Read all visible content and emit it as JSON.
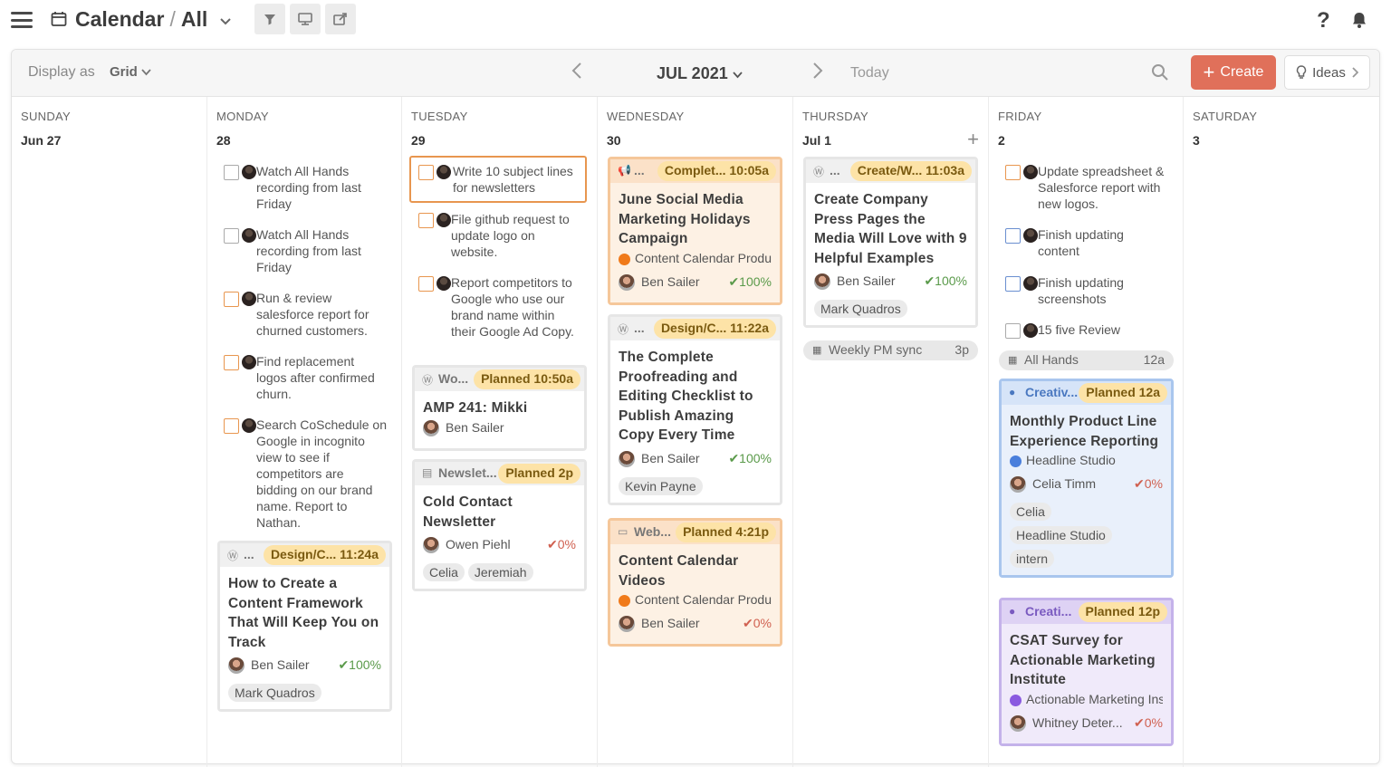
{
  "header": {
    "app": "Calendar",
    "filter": "All"
  },
  "toolbar": {
    "display_as": "Display as",
    "view": "Grid",
    "month": "JUL 2021",
    "today": "Today",
    "create": "Create",
    "ideas": "Ideas"
  },
  "days": [
    {
      "name": "SUNDAY",
      "num": "Jun 27"
    },
    {
      "name": "MONDAY",
      "num": "28"
    },
    {
      "name": "TUESDAY",
      "num": "29"
    },
    {
      "name": "WEDNESDAY",
      "num": "30"
    },
    {
      "name": "THURSDAY",
      "num": "Jul 1"
    },
    {
      "name": "FRIDAY",
      "num": "2"
    },
    {
      "name": "SATURDAY",
      "num": "3"
    }
  ],
  "monday": {
    "t1": "Watch All Hands recording from last Friday",
    "t2": "Watch All Hands recording from last Friday",
    "t3": "Run & review salesforce report for churned customers.",
    "t4": "Find replacement logos after confirmed churn.",
    "t5": "Search CoSchedule on Google in incognito view to see if competitors are bidding on our brand name. Report to Nathan.",
    "card": {
      "label": "...",
      "status": "Design/C... 11:24a",
      "title": "How to Create a Content Framework That Will Keep You on Track",
      "person": "Ben Sailer",
      "pct": "✔100%",
      "tag1": "Mark Quadros"
    }
  },
  "tuesday": {
    "t1": "Write 10 subject lines for newsletters",
    "t2": "File github request to update logo on website.",
    "t3": "Report competitors to Google who use our brand name within their Google Ad Copy.",
    "card1": {
      "label": "Wo...",
      "status": "Planned 10:50a",
      "title": "AMP 241: Mikki",
      "person": "Ben Sailer"
    },
    "card2": {
      "label": "Newslet...",
      "status": "Planned 2p",
      "title": "Cold Contact Newsletter",
      "person": "Owen Piehl",
      "pct": "✔0%",
      "tag1": "Celia",
      "tag2": "Jeremiah"
    }
  },
  "wednesday": {
    "card1": {
      "label": "...",
      "status": "Complet... 10:05a",
      "title": "June Social Media Marketing Holidays Campaign",
      "project": "Content Calendar Produ",
      "person": "Ben Sailer",
      "pct": "✔100%"
    },
    "card2": {
      "label": "...",
      "status": "Design/C... 11:22a",
      "title": "The Complete Proofreading and Editing Checklist to Publish Amazing Copy Every Time",
      "person": "Ben Sailer",
      "pct": "✔100%",
      "tag1": "Kevin Payne"
    },
    "card3": {
      "label": "Web...",
      "status": "Planned 4:21p",
      "title": "Content Calendar Videos",
      "project": "Content Calendar Produ",
      "person": "Ben Sailer",
      "pct": "✔0%"
    }
  },
  "thursday": {
    "card1": {
      "label": "...",
      "status": "Create/W... 11:03a",
      "title": "Create Company Press Pages the Media Will Love with 9 Helpful Examples",
      "person": "Ben Sailer",
      "pct": "✔100%",
      "tag1": "Mark Quadros"
    },
    "event": {
      "title": "Weekly PM sync",
      "time": "3p"
    }
  },
  "friday": {
    "t1": "Update spreadsheet & Salesforce report with new logos.",
    "t2": "Finish updating content",
    "t3": "Finish updating screenshots",
    "t4": "15 five Review",
    "event": {
      "title": "All Hands",
      "time": "12a"
    },
    "card1": {
      "label": "Creativ...",
      "status": "Planned 12a",
      "title": "Monthly Product Line Experience Reporting",
      "project": "Headline Studio",
      "person": "Celia Timm",
      "pct": "✔0%",
      "tag1": "Celia",
      "tag2": "Headline Studio",
      "tag3": "intern"
    },
    "card2": {
      "label": "Creati...",
      "status": "Planned 12p",
      "title": "CSAT Survey for Actionable Marketing Institute",
      "project": "Actionable Marketing Ins",
      "person": "Whitney Deter...",
      "pct": "✔0%"
    }
  },
  "colors": {
    "accent": "#e0705a",
    "orange_card": "#fbe1c8",
    "blue_card": "#d6e4f8",
    "purple_card": "#ded2f4"
  }
}
